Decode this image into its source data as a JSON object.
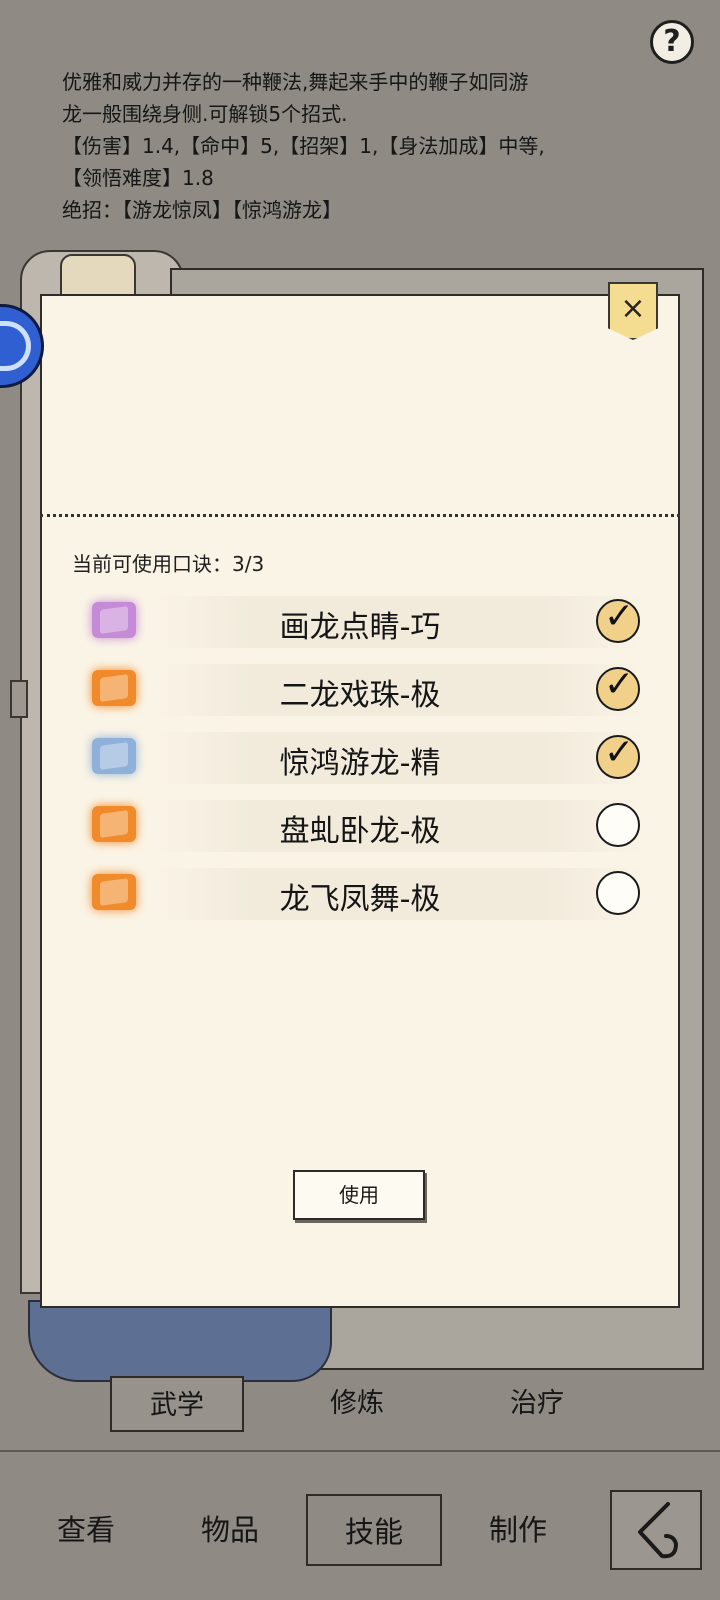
{
  "help": {
    "label": "?"
  },
  "description": {
    "lines": [
      "优雅和威力并存的一种鞭法,舞起来手中的鞭子如同游",
      "龙一般围绕身侧.可解锁5个招式.",
      "【伤害】1.4,【命中】5,【招架】1,【身法加成】中等,",
      "【领悟难度】1.8",
      "绝招：【游龙惊凤】【惊鸿游龙】"
    ]
  },
  "panel": {
    "close_label": "×",
    "quota_text": "当前可使用口诀：3/3",
    "use_label": "使用",
    "skills": [
      {
        "name": "画龙点睛-巧",
        "icon": "scroll-icon-purple",
        "checked": true,
        "color": "#c58bd6"
      },
      {
        "name": "二龙戏珠-极",
        "icon": "scroll-icon-orange",
        "checked": true,
        "color": "#f08a2a"
      },
      {
        "name": "惊鸿游龙-精",
        "icon": "scroll-icon-blue",
        "checked": true,
        "color": "#8fb0d8"
      },
      {
        "name": "盘虬卧龙-极",
        "icon": "scroll-icon-orange",
        "checked": false,
        "color": "#f08a2a"
      },
      {
        "name": "龙飞凤舞-极",
        "icon": "scroll-icon-orange",
        "checked": false,
        "color": "#f08a2a"
      }
    ]
  },
  "subtabs": [
    "武学",
    "修炼",
    "治疗"
  ],
  "bottom_nav": [
    "查看",
    "物品",
    "技能",
    "制作"
  ]
}
